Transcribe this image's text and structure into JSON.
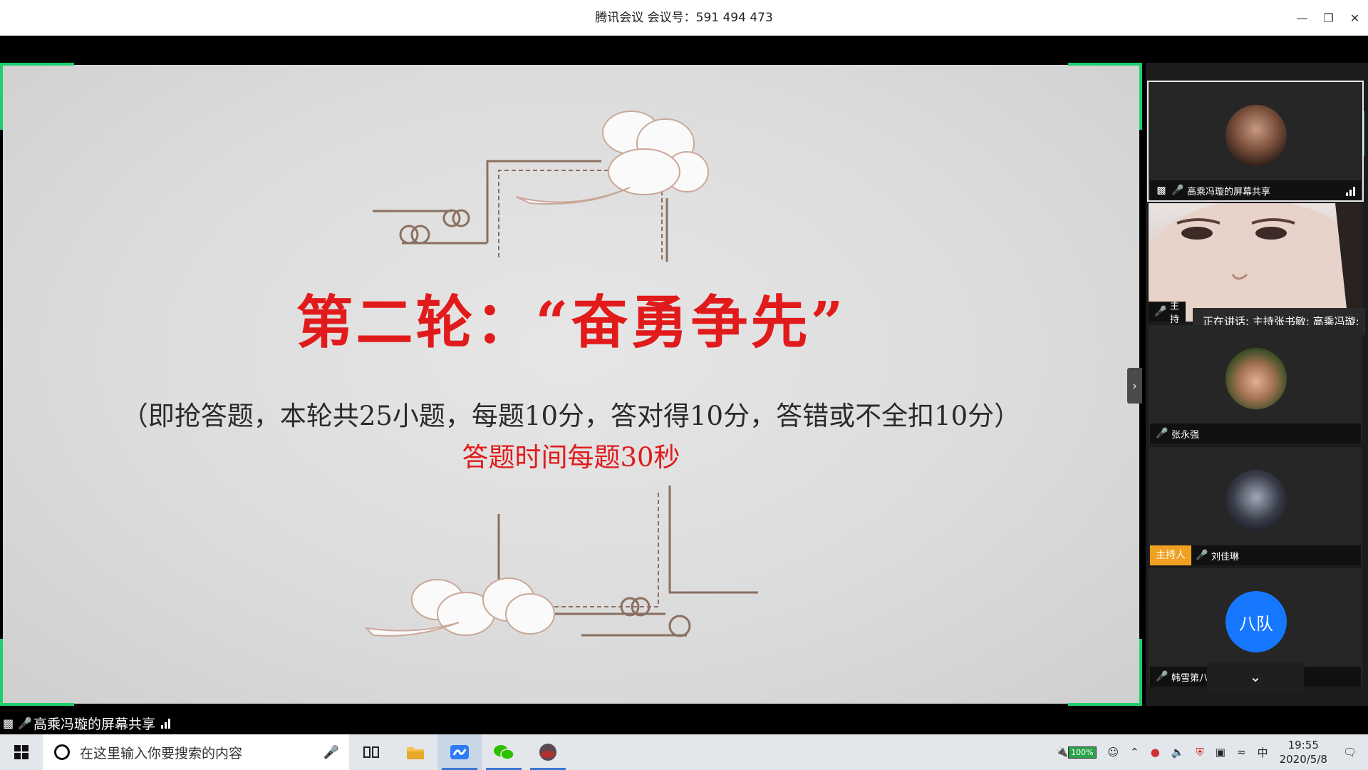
{
  "window": {
    "title": "腾讯会议 会议号：591 494 473",
    "controls": [
      "minimize-icon",
      "restore-icon",
      "close-icon"
    ]
  },
  "slide": {
    "heading": "第二轮：“奋勇争先”",
    "rules": "（即抢答题，本轮共25小题，每题10分，答对得10分，答错或不全扣10分）",
    "timer": "答题时间每题30秒",
    "accent_color": "#e11b1b",
    "share_border_color": "#1ecf6d"
  },
  "participants": [
    {
      "name": "高乘冯璇的屏幕共享",
      "sharing": true,
      "has_signal": true
    },
    {
      "name": "主持"
    },
    {
      "name": "张永强",
      "muted": true
    },
    {
      "name": "刘佳琳",
      "muted": true,
      "badge": "主持人"
    },
    {
      "name": "韩雪第八队",
      "muted": true,
      "avatar_text": "八队",
      "avatar_color": "#1677ff"
    }
  ],
  "speaking": "正在讲话: 主持张书敏; 高乘冯璇;",
  "share_status": "高乘冯璇的屏幕共享",
  "taskbar": {
    "search_placeholder": "在这里输入你要搜索的内容",
    "battery": "100%",
    "ime": "中",
    "time": "19:55",
    "date": "2020/5/8"
  }
}
